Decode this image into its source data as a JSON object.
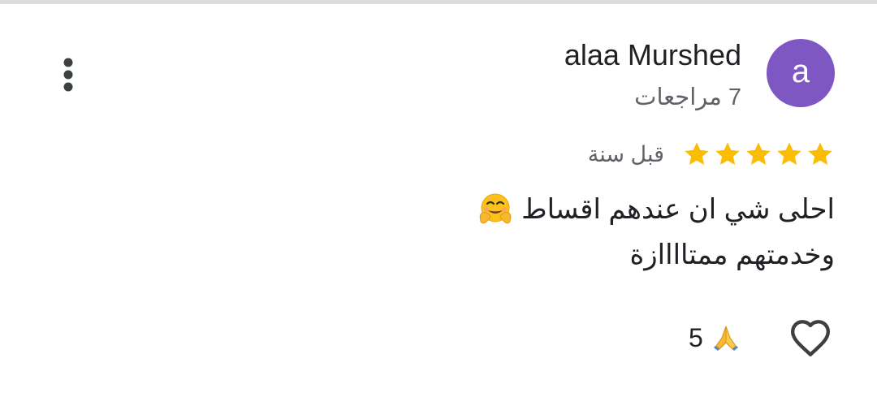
{
  "review": {
    "author": {
      "name": "alaa Murshed",
      "avatar_letter": "a",
      "avatar_color": "#7e57c2",
      "review_count": "7 مراجعات"
    },
    "rating": 5,
    "rating_max": 5,
    "star_color": "#fbbc04",
    "date": "قبل سنة",
    "text_lines": [
      "احلى شي ان عندهم اقساط",
      "وخدمتهم ممتاااازة"
    ],
    "text_emoji": "hugging-face-icon",
    "reactions": {
      "icon": "folded-hands-icon",
      "count": "5"
    }
  },
  "icons": {
    "menu": "more-vert-icon",
    "like": "heart-outline-icon"
  }
}
